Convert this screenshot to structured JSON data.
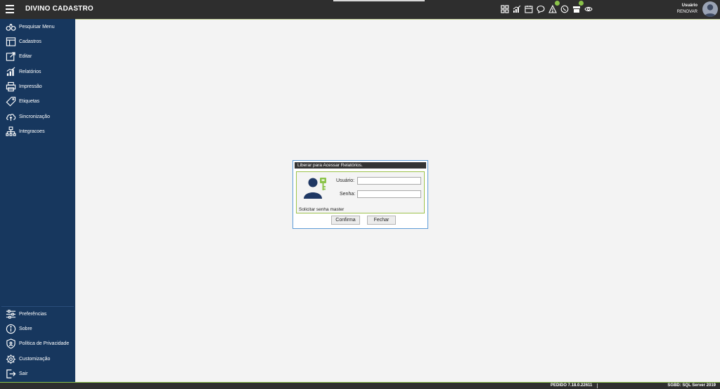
{
  "app": {
    "title": "DIVINO CADASTRO"
  },
  "header": {
    "user_label": "Usuário",
    "user_sub": "RENOVAR",
    "icons": [
      "dashboard-icon",
      "chart-icon",
      "calendar-icon",
      "chat-icon",
      "alert-icon",
      "whatsapp-icon",
      "store-icon",
      "eye-icon"
    ],
    "alert_badge": "",
    "store_badge": ""
  },
  "sidebar": {
    "items": [
      {
        "label": "Pesquisar Menu",
        "icon": "binoculars-icon"
      },
      {
        "label": "Cadastros",
        "icon": "table-icon"
      },
      {
        "label": "Editar",
        "icon": "edit-icon"
      },
      {
        "label": "Relatórios",
        "icon": "report-chart-icon"
      },
      {
        "label": "Impressão",
        "icon": "printer-icon"
      },
      {
        "label": "Etiquetas",
        "icon": "tag-icon"
      },
      {
        "label": "Sincronização",
        "icon": "cloud-sync-icon"
      },
      {
        "label": "Integracoes",
        "icon": "network-icon"
      }
    ],
    "bottom_items": [
      {
        "label": "Preferências",
        "icon": "sliders-icon"
      },
      {
        "label": "Sobre",
        "icon": "info-icon"
      },
      {
        "label": "Política de Privacidade",
        "icon": "shield-icon"
      },
      {
        "label": "Customização",
        "icon": "customize-icon"
      },
      {
        "label": "Sair",
        "icon": "exit-icon"
      }
    ]
  },
  "dialog": {
    "title": "Liberar para Acessar Relatórios.",
    "usuario_label": "Usuário:",
    "senha_label": "Senha:",
    "usuario_value": "",
    "senha_value": "",
    "master_link": "Solicitar senha master",
    "confirm_button": "Confirma",
    "close_button": "Fechar"
  },
  "statusbar": {
    "version": "PEDIDO 7.18.0.22611",
    "database": "SGBD: SQL Server 2019"
  },
  "colors": {
    "sidebar": "#17375e",
    "topbar": "#2e2e2e",
    "accent": "#8bc34a",
    "dialog_border": "#5d9bd6"
  }
}
